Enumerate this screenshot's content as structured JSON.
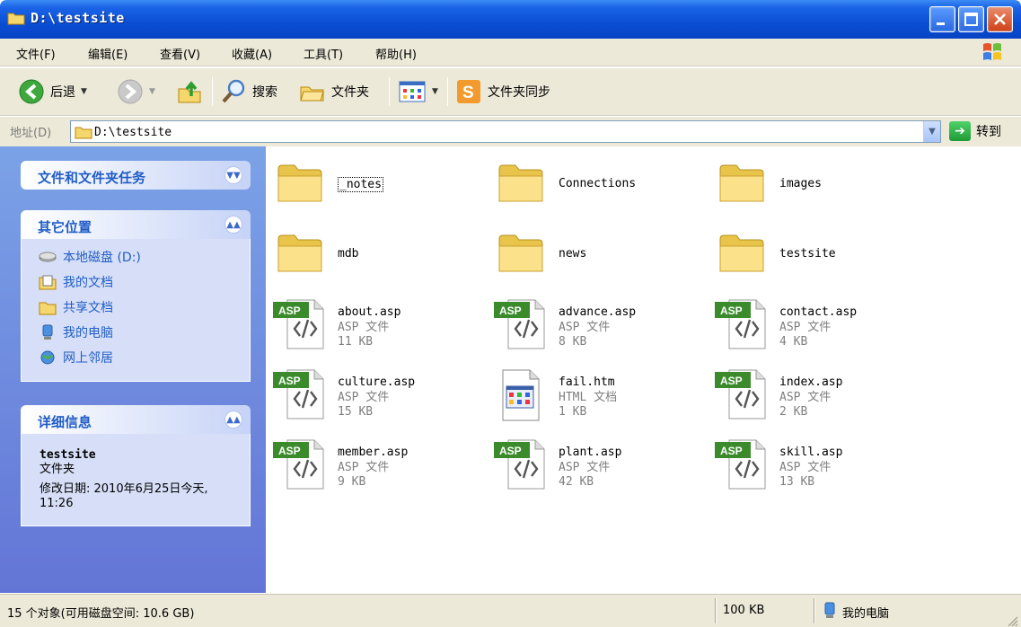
{
  "window": {
    "title": "D:\\testsite"
  },
  "menu": {
    "items": [
      "文件(F)",
      "编辑(E)",
      "查看(V)",
      "收藏(A)",
      "工具(T)",
      "帮助(H)"
    ]
  },
  "toolbar": {
    "back_label": "后退",
    "search_label": "搜索",
    "folders_label": "文件夹",
    "sync_label": "文件夹同步"
  },
  "address": {
    "label": "地址(D)",
    "value": "D:\\testsite",
    "go_label": "转到"
  },
  "sidebar": {
    "tasks_title": "文件和文件夹任务",
    "other_title": "其它位置",
    "places": [
      {
        "label": "本地磁盘 (D:)",
        "icon": "drive-icon"
      },
      {
        "label": "我的文档",
        "icon": "my-documents-icon"
      },
      {
        "label": "共享文档",
        "icon": "shared-documents-icon"
      },
      {
        "label": "我的电脑",
        "icon": "my-computer-icon"
      },
      {
        "label": "网上邻居",
        "icon": "network-icon"
      }
    ],
    "details_title": "详细信息",
    "details_name": "testsite",
    "details_type": "文件夹",
    "details_modified": "修改日期: 2010年6月25日今天, 11:26"
  },
  "folders": [
    {
      "name": "_notes"
    },
    {
      "name": "Connections"
    },
    {
      "name": "images"
    },
    {
      "name": "mdb"
    },
    {
      "name": "news"
    },
    {
      "name": "testsite"
    }
  ],
  "files": [
    {
      "name": "about.asp",
      "type": "ASP 文件",
      "size": "11 KB",
      "icon": "asp-file-icon"
    },
    {
      "name": "advance.asp",
      "type": "ASP 文件",
      "size": "8 KB",
      "icon": "asp-file-icon"
    },
    {
      "name": "contact.asp",
      "type": "ASP 文件",
      "size": "4 KB",
      "icon": "asp-file-icon"
    },
    {
      "name": "culture.asp",
      "type": "ASP 文件",
      "size": "15 KB",
      "icon": "asp-file-icon"
    },
    {
      "name": "fail.htm",
      "type": "HTML 文档",
      "size": "1 KB",
      "icon": "html-file-icon"
    },
    {
      "name": "index.asp",
      "type": "ASP 文件",
      "size": "2 KB",
      "icon": "asp-file-icon"
    },
    {
      "name": "member.asp",
      "type": "ASP 文件",
      "size": "9 KB",
      "icon": "asp-file-icon"
    },
    {
      "name": "plant.asp",
      "type": "ASP 文件",
      "size": "42 KB",
      "icon": "asp-file-icon"
    },
    {
      "name": "skill.asp",
      "type": "ASP 文件",
      "size": "13 KB",
      "icon": "asp-file-icon"
    }
  ],
  "file_badge": "ASP",
  "status": {
    "objects": "15 个对象(可用磁盘空间: 10.6 GB)",
    "size": "100 KB",
    "location": "我的电脑"
  }
}
